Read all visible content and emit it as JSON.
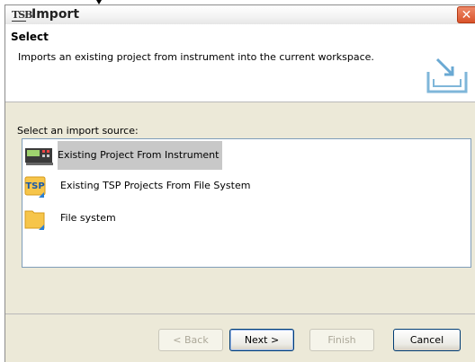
{
  "window": {
    "title": "Import",
    "app_icon_text": "TSB",
    "close_icon": "close-icon"
  },
  "header": {
    "title": "Select",
    "description": "Imports an existing project from instrument into the current workspace."
  },
  "source": {
    "label": "Select an import source:",
    "items": [
      {
        "label": "Existing Project From Instrument",
        "icon": "instrument-icon",
        "selected": true
      },
      {
        "label": "Existing TSP Projects From File System",
        "icon": "tsp-folder-icon",
        "selected": false,
        "icon_text": "TSP"
      },
      {
        "label": "File system",
        "icon": "folder-icon",
        "selected": false
      }
    ]
  },
  "buttons": {
    "back": "< Back",
    "next": "Next >",
    "finish": "Finish",
    "cancel": "Cancel"
  },
  "colors": {
    "selection": "#c8c8c8",
    "dialog_bg": "#ece9d8",
    "close_red": "#d9532a"
  }
}
